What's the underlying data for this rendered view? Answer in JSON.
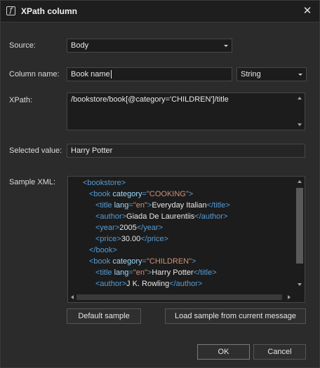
{
  "window": {
    "title": "XPath column",
    "title_icon": "function-icon",
    "close_glyph": "✕"
  },
  "source": {
    "label": "Source:",
    "value": "Body"
  },
  "column_name": {
    "label": "Column name:",
    "value": "Book name",
    "type_value": "String"
  },
  "xpath": {
    "label": "XPath:",
    "value": "/bookstore/book[@category='CHILDREN']/title"
  },
  "selected_value": {
    "label": "Selected value:",
    "value": "Harry Potter"
  },
  "sample_xml": {
    "label": "Sample XML:",
    "lines": [
      {
        "indent": 0,
        "parts": [
          [
            "t",
            "<bookstore>"
          ]
        ]
      },
      {
        "indent": 1,
        "parts": [
          [
            "t",
            "<book "
          ],
          [
            "a",
            "category"
          ],
          [
            "t",
            "="
          ],
          [
            "v",
            "\"COOKING\""
          ],
          [
            "t",
            ">"
          ]
        ]
      },
      {
        "indent": 2,
        "parts": [
          [
            "t",
            "<title "
          ],
          [
            "a",
            "lang"
          ],
          [
            "t",
            "="
          ],
          [
            "v",
            "\"en\""
          ],
          [
            "t",
            ">"
          ],
          [
            "x",
            "Everyday Italian"
          ],
          [
            "t",
            "</title>"
          ]
        ]
      },
      {
        "indent": 2,
        "parts": [
          [
            "t",
            "<author>"
          ],
          [
            "x",
            "Giada De Laurentiis"
          ],
          [
            "t",
            "</author>"
          ]
        ]
      },
      {
        "indent": 2,
        "parts": [
          [
            "t",
            "<year>"
          ],
          [
            "x",
            "2005"
          ],
          [
            "t",
            "</year>"
          ]
        ]
      },
      {
        "indent": 2,
        "parts": [
          [
            "t",
            "<price>"
          ],
          [
            "x",
            "30.00"
          ],
          [
            "t",
            "</price>"
          ]
        ]
      },
      {
        "indent": 1,
        "parts": [
          [
            "t",
            "</book>"
          ]
        ]
      },
      {
        "indent": 1,
        "parts": [
          [
            "t",
            "<book "
          ],
          [
            "a",
            "category"
          ],
          [
            "t",
            "="
          ],
          [
            "v",
            "\"CHILDREN\""
          ],
          [
            "t",
            ">"
          ]
        ]
      },
      {
        "indent": 2,
        "parts": [
          [
            "t",
            "<title "
          ],
          [
            "a",
            "lang"
          ],
          [
            "t",
            "="
          ],
          [
            "v",
            "\"en\""
          ],
          [
            "t",
            ">"
          ],
          [
            "x",
            "Harry Potter"
          ],
          [
            "t",
            "</title>"
          ]
        ]
      },
      {
        "indent": 2,
        "parts": [
          [
            "t",
            "<author>"
          ],
          [
            "x",
            "J K. Rowling"
          ],
          [
            "t",
            "</author>"
          ]
        ]
      }
    ]
  },
  "buttons": {
    "default_sample": "Default sample",
    "load_sample": "Load sample from current message",
    "ok": "OK",
    "cancel": "Cancel"
  },
  "colors": {
    "xml_tag": "#569cd6",
    "xml_attr": "#9cdcfe",
    "xml_value": "#ce9178",
    "background": "#2b2b2b"
  }
}
